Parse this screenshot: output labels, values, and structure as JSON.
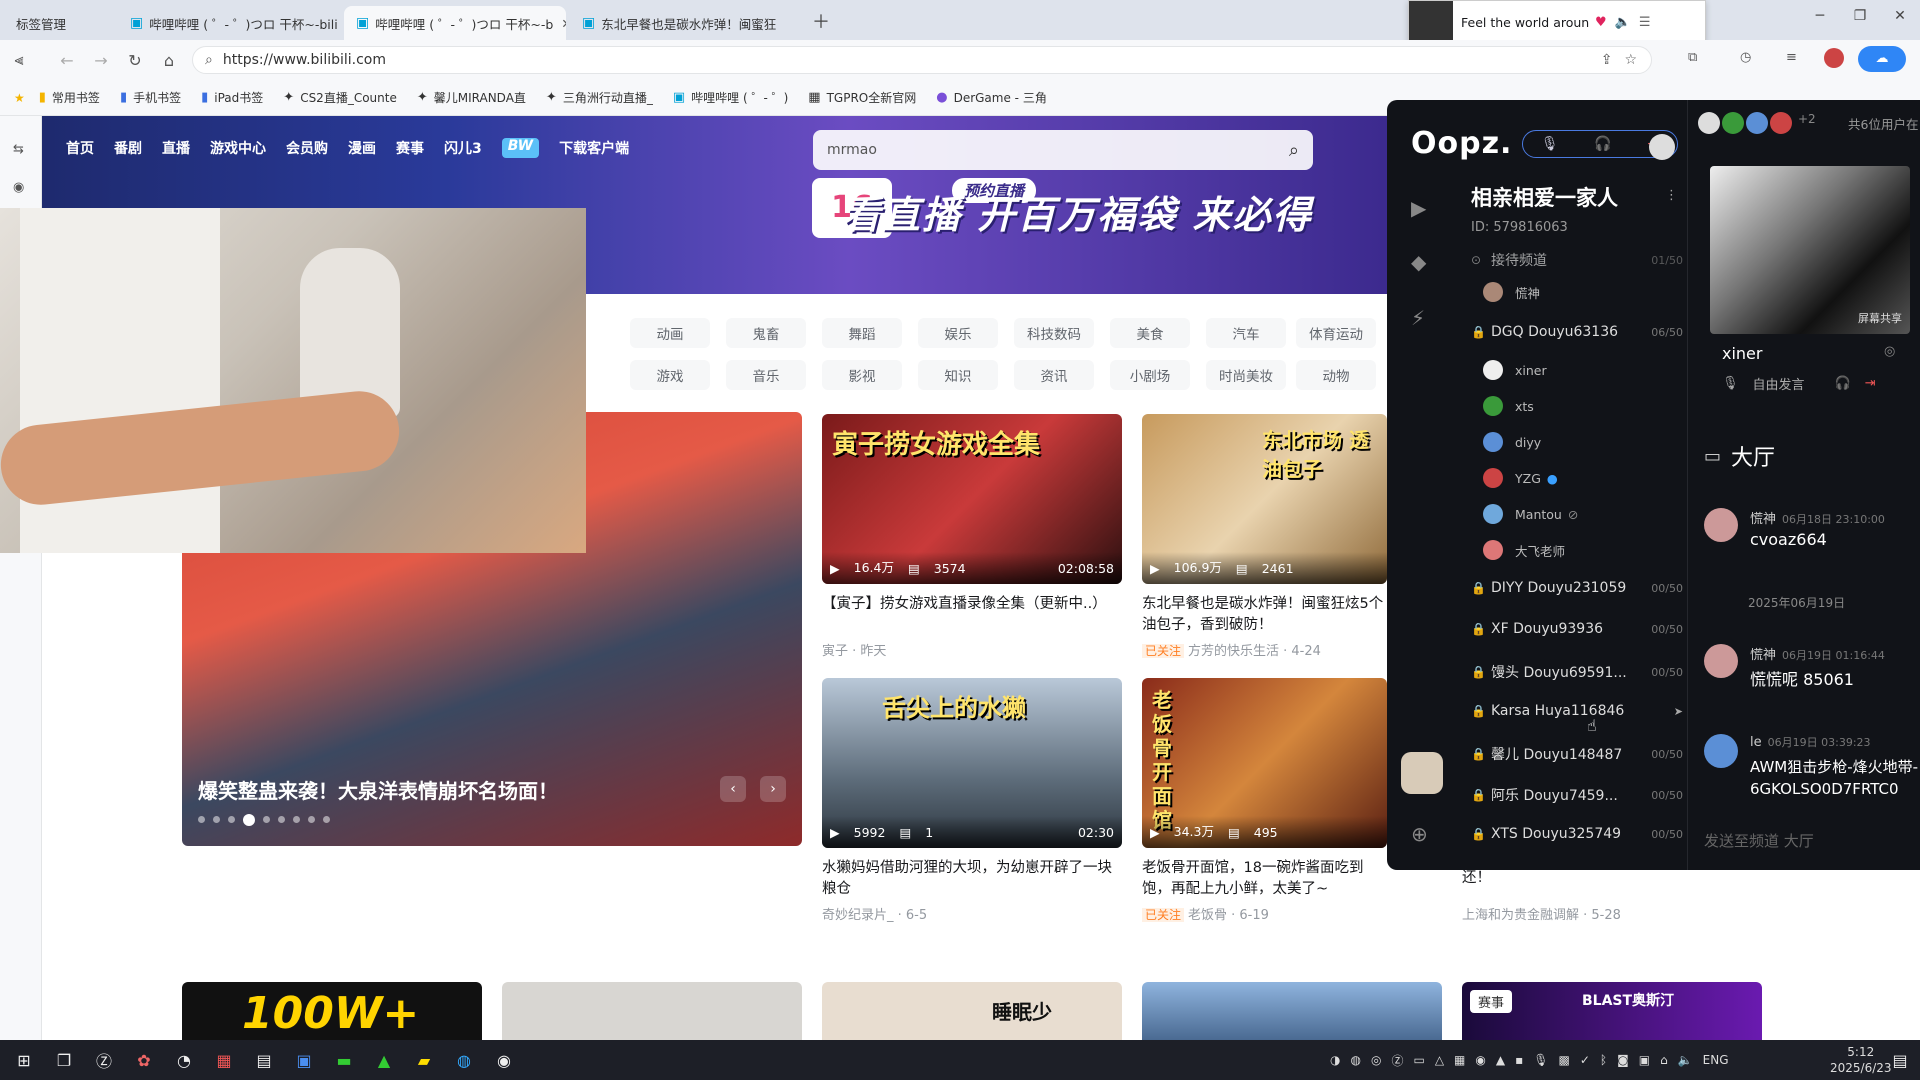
{
  "browser": {
    "tabs": [
      {
        "label": "标签管理"
      },
      {
        "label": "哔哩哔哩 ( ゜- ゜)つロ 干杯~-bili"
      },
      {
        "label": "哔哩哔哩 ( ゜- ゜)つロ 干杯~-b"
      },
      {
        "label": "东北早餐也是碳水炸弹！闽蜜狂"
      }
    ],
    "url": "https://www.bilibili.com",
    "bookmarks": [
      "常用书签",
      "手机书签",
      "iPad书签",
      "CS2直播_Counte",
      "馨儿MIRANDA直",
      "三角洲行动直播_",
      "哔哩哔哩 ( ゜- ゜)",
      "TGPRO全新官网",
      "DerGame - 三角"
    ],
    "media_popup": {
      "title": "Feel the world around yo"
    }
  },
  "bili": {
    "nav": [
      "首页",
      "番剧",
      "直播",
      "游戏中心",
      "会员购",
      "漫画",
      "赛事",
      "闪儿3",
      "下载客户端"
    ],
    "search_value": "mrmao",
    "banner_text": "看直播 开百万福袋 来必得",
    "banner_sub": "预约直播",
    "categories_row1": [
      "动画",
      "鬼畜",
      "舞蹈",
      "娱乐",
      "科技数码",
      "美食",
      "汽车",
      "体育运动"
    ],
    "categories_row2": [
      "游戏",
      "音乐",
      "影视",
      "知识",
      "资讯",
      "小剧场",
      "时尚美妆",
      "动物"
    ],
    "carousel_caption": "爆笑整蛊来袭！大泉洋表情崩坏名场面！",
    "cards": [
      {
        "thumb_text": "寅子捞女游戏全集",
        "views": "16.4万",
        "danmaku": "3574",
        "duration": "02:08:58",
        "title": "【寅子】捞女游戏直播录像全集（更新中..）",
        "followed": "",
        "author": "寅子 · 昨天"
      },
      {
        "thumb_text": "东北市场 透油包子",
        "views": "106.9万",
        "danmaku": "2461",
        "duration": "",
        "title": "东北早餐也是碳水炸弹！闽蜜狂炫5个油包子，香到破防！",
        "followed": "已关注",
        "author": "方芳的快乐生活 · 4-24"
      },
      {
        "thumb_text": "舌尖上的水獭",
        "views": "5992",
        "danmaku": "1",
        "duration": "02:30",
        "title": "水獭妈妈借助河狸的大坝，为幼崽开辟了一块粮仓",
        "followed": "",
        "author": "奇妙纪录片_ · 6-5"
      },
      {
        "thumb_text": "老饭骨开面馆",
        "views": "34.3万",
        "danmaku": "495",
        "duration": "",
        "title": "老饭骨开面馆，18一碗炸酱面吃到饱，再配上九小鲜，太美了~",
        "followed": "已关注",
        "author": "老饭骨 · 6-19"
      }
    ],
    "extra_card": {
      "title": "还！",
      "author": "上海和为贵金融调解 · 5-28"
    },
    "bottom_tag": "赛事",
    "bottom_thumb_texts": [
      "100W+",
      "",
      "睡眠少",
      "",
      "BLAST奥斯汀"
    ]
  },
  "oopz": {
    "logo": "Oopz.",
    "server_name": "相亲相爱一家人",
    "server_id": "ID: 579816063",
    "top_channel": "接待频道",
    "top_channel_count": "01/50",
    "top_channel_members": [
      "慌神"
    ],
    "active_channel": "DGQ Douyu63136",
    "active_count": "06/50",
    "members": [
      "xiner",
      "xts",
      "diyy",
      "YZG",
      "Mantou",
      "大飞老师"
    ],
    "channels": [
      {
        "name": "DIYY Douyu231059",
        "count": "00/50"
      },
      {
        "name": "XF Douyu93936",
        "count": "00/50"
      },
      {
        "name": "馒头 Douyu69591...",
        "count": "00/50"
      },
      {
        "name": "Karsa Huya116846",
        "count": ""
      },
      {
        "name": "馨儿 Douyu148487",
        "count": "00/50"
      },
      {
        "name": "阿乐 Douyu7459...",
        "count": "00/50"
      },
      {
        "name": "XTS Douyu325749",
        "count": "00/50"
      }
    ],
    "online_count": "+2",
    "online_label": "共6位用户在",
    "screen_share": "屏幕共享",
    "current_user": "xiner",
    "mic_mode": "自由发言",
    "lobby_title": "大厅",
    "date_divider": "2025年06月19日",
    "messages": [
      {
        "name": "慌神",
        "time": "06月18日 23:10:00",
        "text": "cvoaz664"
      },
      {
        "name": "慌神",
        "time": "06月19日 01:16:44",
        "text": "慌慌呢 85061"
      },
      {
        "name": "le",
        "time": "06月19日 03:39:23",
        "text": "AWM狙击步枪-烽火地带-6GKOLSO0D7FRTC0"
      }
    ],
    "send_placeholder": "发送至频道 大厅"
  },
  "taskbar": {
    "lang": "ENG",
    "time": "5:12",
    "date": "2025/6/23"
  },
  "colors": {
    "bili_pink": "#fb7299",
    "oopz_bg": "#111318",
    "accent_blue": "#00a1d6"
  }
}
